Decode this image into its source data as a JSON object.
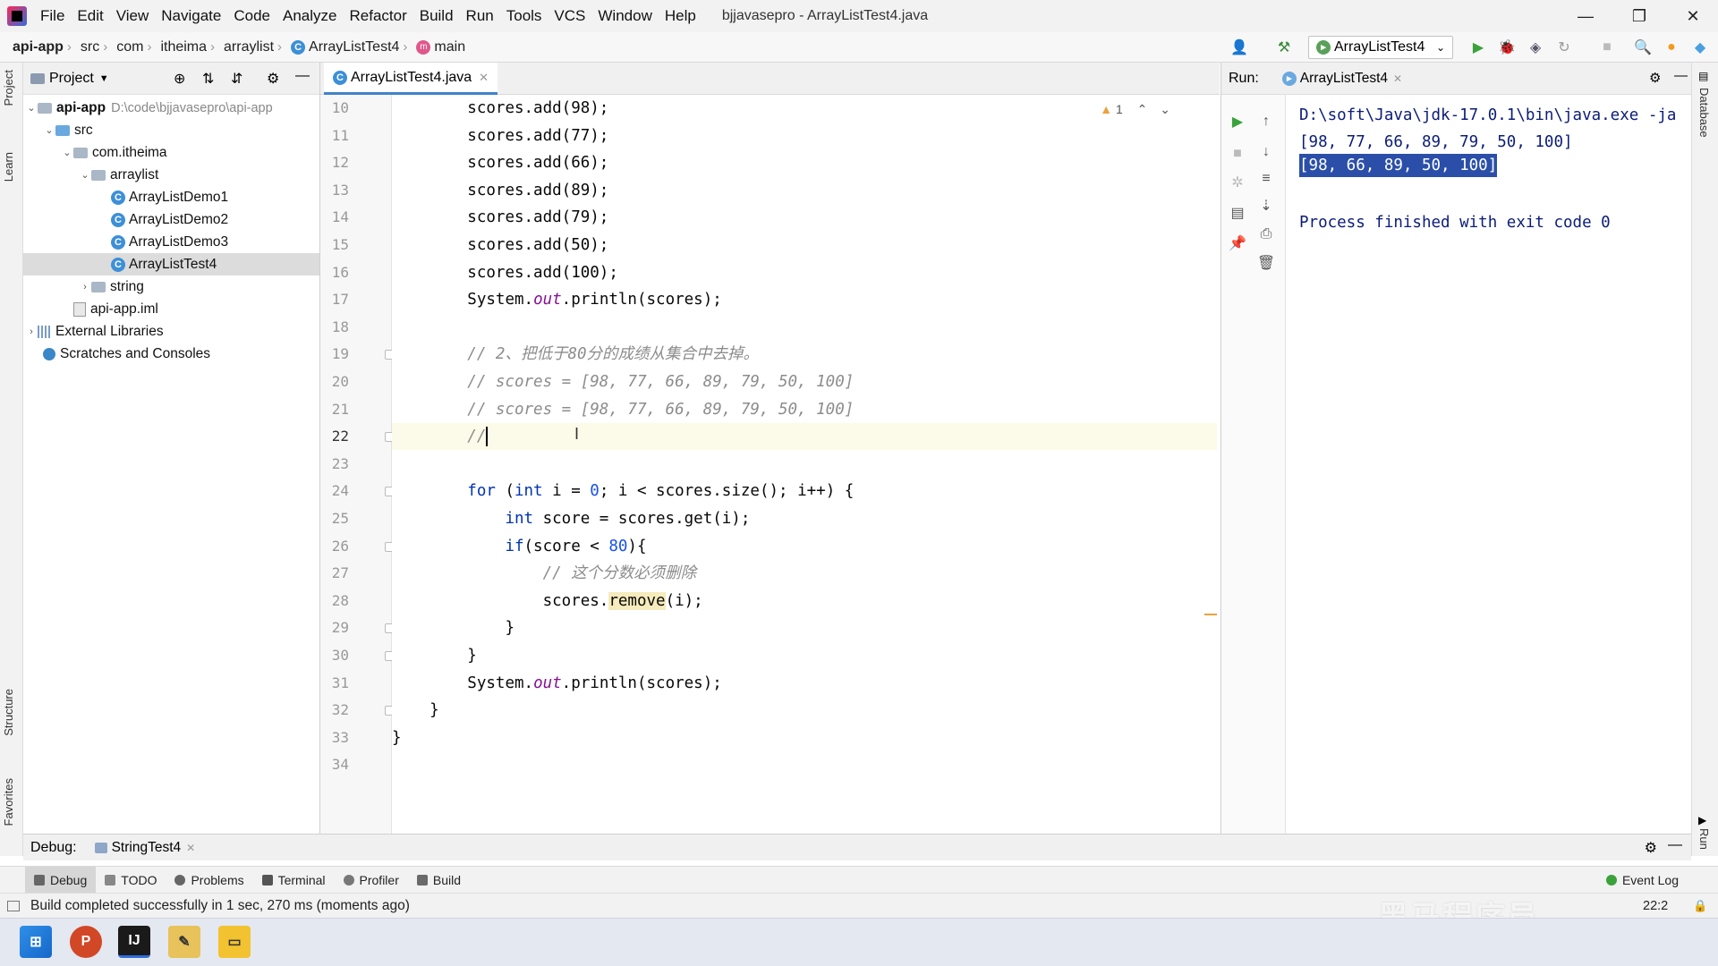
{
  "menu": {
    "items": [
      "File",
      "Edit",
      "View",
      "Navigate",
      "Code",
      "Analyze",
      "Refactor",
      "Build",
      "Run",
      "Tools",
      "VCS",
      "Window",
      "Help"
    ],
    "window_title": "bjjavasepro - ArrayListTest4.java"
  },
  "breadcrumb": [
    "api-app",
    "src",
    "com",
    "itheima",
    "arraylist",
    "ArrayListTest4",
    "main"
  ],
  "run_config": "ArrayListTest4",
  "project": {
    "header": "Project",
    "tree": [
      {
        "label": "api-app",
        "extra": "D:\\code\\bjjavasepro\\api-app"
      },
      {
        "label": "src"
      },
      {
        "label": "com.itheima"
      },
      {
        "label": "arraylist"
      },
      {
        "label": "ArrayListDemo1"
      },
      {
        "label": "ArrayListDemo2"
      },
      {
        "label": "ArrayListDemo3"
      },
      {
        "label": "ArrayListTest4"
      },
      {
        "label": "string"
      },
      {
        "label": "api-app.iml"
      },
      {
        "label": "External Libraries"
      },
      {
        "label": "Scratches and Consoles"
      }
    ]
  },
  "side_tabs": {
    "left": [
      "Project",
      "Learn",
      "Structure",
      "Favorites"
    ],
    "right": [
      "Database",
      "Run"
    ]
  },
  "editor": {
    "tab": "ArrayListTest4.java",
    "warning_count": "1",
    "line_numbers": [
      "10",
      "11",
      "12",
      "13",
      "14",
      "15",
      "16",
      "17",
      "18",
      "19",
      "20",
      "21",
      "22",
      "23",
      "24",
      "25",
      "26",
      "27",
      "28",
      "29",
      "30",
      "31",
      "32",
      "33",
      "34"
    ],
    "lines": {
      "l10": "scores.add(98);",
      "l11": "scores.add(77);",
      "l12": "scores.add(66);",
      "l13": "scores.add(89);",
      "l14": "scores.add(79);",
      "l15": "scores.add(50);",
      "l16": "scores.add(100);",
      "l17a": "System.",
      "l17b": "out",
      "l17c": ".println(scores);",
      "l19": "// 2、把低于80分的成绩从集合中去掉。",
      "l20": "// scores = [98, 77, 66, 89, 79, 50, 100]",
      "l21": "// scores = [98, 77, 66, 89, 79, 50, 100]",
      "l22": "//",
      "l24a": "for",
      "l24b": " (",
      "l24c": "int",
      "l24d": " i = ",
      "l24e": "0",
      "l24f": "; i < scores.size(); i++) {",
      "l25a": "int",
      "l25b": " score = scores.get(i);",
      "l26a": "if",
      "l26b": "(score < ",
      "l26c": "80",
      "l26d": "){",
      "l27": "// 这个分数必须删除",
      "l28a": "scores.",
      "l28b": "remove",
      "l28c": "(i);",
      "l29": "}",
      "l30": "}",
      "l31a": "System.",
      "l31b": "out",
      "l31c": ".println(scores);",
      "l32": "}",
      "l33": "}"
    }
  },
  "run": {
    "label": "Run:",
    "tab": "ArrayListTest4",
    "output": [
      "D:\\soft\\Java\\jdk-17.0.1\\bin\\java.exe -ja",
      "[98, 77, 66, 89, 79, 50, 100]",
      "[98, 66, 89, 50, 100]",
      "",
      "Process finished with exit code 0"
    ]
  },
  "debug": {
    "label": "Debug:",
    "tab": "StringTest4"
  },
  "tool_windows": [
    "Debug",
    "TODO",
    "Problems",
    "Terminal",
    "Profiler",
    "Build"
  ],
  "event_log": "Event Log",
  "status": {
    "message": "Build completed successfully in 1 sec, 270 ms (moments ago)",
    "position": "22:2"
  },
  "watermark": "黑马程序员",
  "colors": {
    "keyword": "#0033b3",
    "number": "#1750eb",
    "comment": "#8c8c8c",
    "field": "#871094",
    "console": "#0b1c7a",
    "selection": "#2b4fa8"
  }
}
